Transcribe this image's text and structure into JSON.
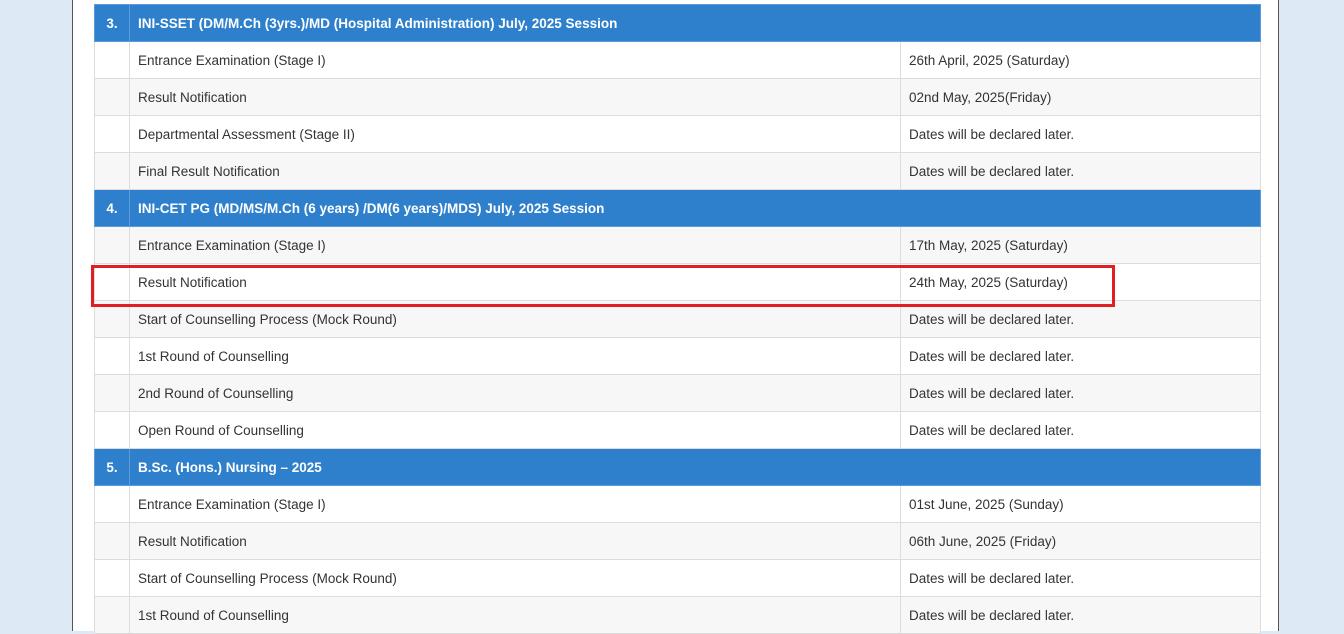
{
  "sections": [
    {
      "number": "3.",
      "title": "INI-SSET (DM/M.Ch (3yrs.)/MD (Hospital Administration) July, 2025 Session",
      "rows": [
        {
          "event": "Entrance Examination (Stage I)",
          "date": "26th April, 2025 (Saturday)"
        },
        {
          "event": "Result Notification",
          "date": "02nd May, 2025(Friday)"
        },
        {
          "event": "Departmental Assessment (Stage II)",
          "date": "Dates will be declared later."
        },
        {
          "event": "Final Result Notification",
          "date": "Dates will be declared later."
        }
      ]
    },
    {
      "number": "4.",
      "title": "INI-CET PG (MD/MS/M.Ch (6 years) /DM(6 years)/MDS) July, 2025 Session",
      "rows": [
        {
          "event": "Entrance Examination (Stage I)",
          "date": "17th May, 2025 (Saturday)"
        },
        {
          "event": "Result Notification",
          "date": "24th May, 2025 (Saturday)"
        },
        {
          "event": "Start of Counselling Process (Mock Round)",
          "date": "Dates will be declared later."
        },
        {
          "event": "1st Round of Counselling",
          "date": "Dates will be declared later."
        },
        {
          "event": "2nd Round of Counselling",
          "date": "Dates will be declared later."
        },
        {
          "event": "Open Round of Counselling",
          "date": "Dates will be declared later."
        }
      ]
    },
    {
      "number": "5.",
      "title": "B.Sc. (Hons.) Nursing – 2025",
      "rows": [
        {
          "event": "Entrance Examination (Stage I)",
          "date": "01st June, 2025 (Sunday)"
        },
        {
          "event": "Result Notification",
          "date": "06th June, 2025 (Friday)"
        },
        {
          "event": "Start of Counselling Process (Mock Round)",
          "date": "Dates will be declared later."
        },
        {
          "event": "1st Round of Counselling",
          "date": "Dates will be declared later."
        }
      ]
    }
  ],
  "colors": {
    "section_header": "#2f80cc",
    "highlight": "#e02020",
    "page_background": "#dde9f5"
  }
}
